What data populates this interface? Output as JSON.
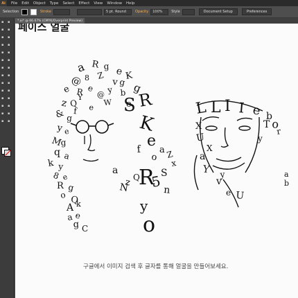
{
  "menubar": {
    "logo": "Ai",
    "items": [
      "File",
      "Edit",
      "Object",
      "Type",
      "Select",
      "Effect",
      "View",
      "Window",
      "Help"
    ]
  },
  "control_bar": {
    "mode_label": "Selection",
    "stroke_label": "Stroke",
    "brush_value": "5 pt. Round",
    "opacity_label": "Opacity",
    "opacity_value": "100%",
    "style_label": "Style",
    "document_setup_label": "Document Setup",
    "preferences_label": "Preferences"
  },
  "document_tab": {
    "title": "*.ai* @ 66.67% (CMYK/Overprint Preview)"
  },
  "tools": [
    "selection",
    "direct-selection",
    "magic-wand",
    "lasso",
    "pen",
    "type",
    "line",
    "rectangle",
    "paintbrush",
    "pencil",
    "blob-brush",
    "eraser",
    "rotate",
    "scale",
    "width",
    "free-transform",
    "shape-builder",
    "perspective-grid",
    "mesh",
    "gradient",
    "eyedropper",
    "blend",
    "symbol-sprayer",
    "column-graph",
    "artboard",
    "slice",
    "hand",
    "zoom"
  ],
  "colors": {
    "fill": "#ffffff",
    "stroke_none": "#d00000",
    "accent": "#ffb04a"
  },
  "artboard": {
    "title": "페이스 얼굴",
    "caption": "구글에서 이미지 검색 후 글자를 통해 얼굴을 만들어보세요.",
    "ab_text": "a b"
  },
  "letters": {
    "hair_left": [
      "a",
      "R",
      "g",
      "e",
      "K",
      "@",
      "8",
      "Z",
      "v",
      "g",
      "e",
      "R",
      "b",
      "z",
      "Q",
      "e",
      "&",
      "g",
      "y",
      "e",
      "M",
      "g",
      "q",
      "a",
      "k",
      "y",
      "8",
      "e",
      "R",
      "g",
      "o",
      "Q",
      "A",
      "e",
      "g",
      "Y",
      "e",
      "y",
      "g",
      "f",
      "k",
      "a",
      "C",
      "e",
      "W",
      "@"
    ],
    "face_left": [
      "S",
      "R",
      "K",
      "e",
      "f",
      "o",
      "a",
      "Z",
      "R",
      "5",
      "a",
      "N",
      "S",
      "n",
      "y",
      "o",
      "Q",
      "z",
      "x"
    ],
    "face_right": [
      "L",
      "L",
      "I",
      "I",
      "e",
      "b",
      "o",
      "T",
      "r",
      "y",
      "X",
      "U",
      "a",
      "Y",
      "v",
      "e",
      "U",
      "y",
      "X"
    ]
  }
}
